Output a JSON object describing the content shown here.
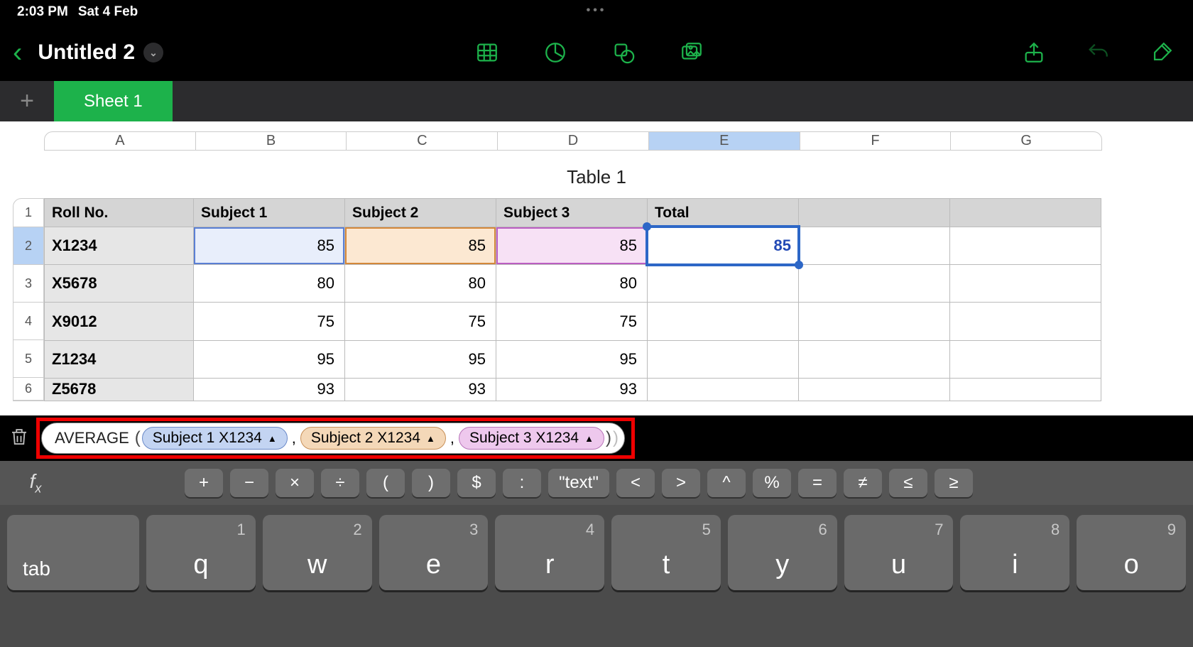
{
  "status": {
    "time": "2:03 PM",
    "date": "Sat 4 Feb"
  },
  "doc": {
    "title": "Untitled 2"
  },
  "sheet": {
    "tab": "Sheet 1",
    "table_title": "Table 1"
  },
  "columns": [
    "A",
    "B",
    "C",
    "D",
    "E",
    "F",
    "G"
  ],
  "headers": {
    "a": "Roll No.",
    "b": "Subject 1",
    "c": "Subject 2",
    "d": "Subject 3",
    "e": "Total"
  },
  "rows": [
    {
      "n": "1"
    },
    {
      "n": "2",
      "a": "X1234",
      "b": "85",
      "c": "85",
      "d": "85",
      "e": "85"
    },
    {
      "n": "3",
      "a": "X5678",
      "b": "80",
      "c": "80",
      "d": "80"
    },
    {
      "n": "4",
      "a": "X9012",
      "b": "75",
      "c": "75",
      "d": "75"
    },
    {
      "n": "5",
      "a": "Z1234",
      "b": "95",
      "c": "95",
      "d": "95"
    },
    {
      "n": "6",
      "a": "Z5678",
      "b": "93",
      "c": "93",
      "d": "93"
    }
  ],
  "formula": {
    "fn": "AVERAGE",
    "t1": "Subject 1 X1234",
    "t2": "Subject 2 X1234",
    "t3": "Subject 3 X1234"
  },
  "symbols": {
    "plus": "+",
    "minus": "−",
    "times": "×",
    "div": "÷",
    "lpar": "(",
    "rpar": ")",
    "dollar": "$",
    "colon": ":",
    "text": "\"text\"",
    "lt": "<",
    "gt": ">",
    "caret": "^",
    "pct": "%",
    "eq": "=",
    "neq": "≠",
    "le": "≤",
    "ge": "≥"
  },
  "kbd": {
    "tab": "tab",
    "keys": [
      {
        "alt": "1",
        "main": "q"
      },
      {
        "alt": "2",
        "main": "w"
      },
      {
        "alt": "3",
        "main": "e"
      },
      {
        "alt": "4",
        "main": "r"
      },
      {
        "alt": "5",
        "main": "t"
      },
      {
        "alt": "6",
        "main": "y"
      },
      {
        "alt": "7",
        "main": "u"
      },
      {
        "alt": "8",
        "main": "i"
      },
      {
        "alt": "9",
        "main": "o"
      }
    ]
  }
}
